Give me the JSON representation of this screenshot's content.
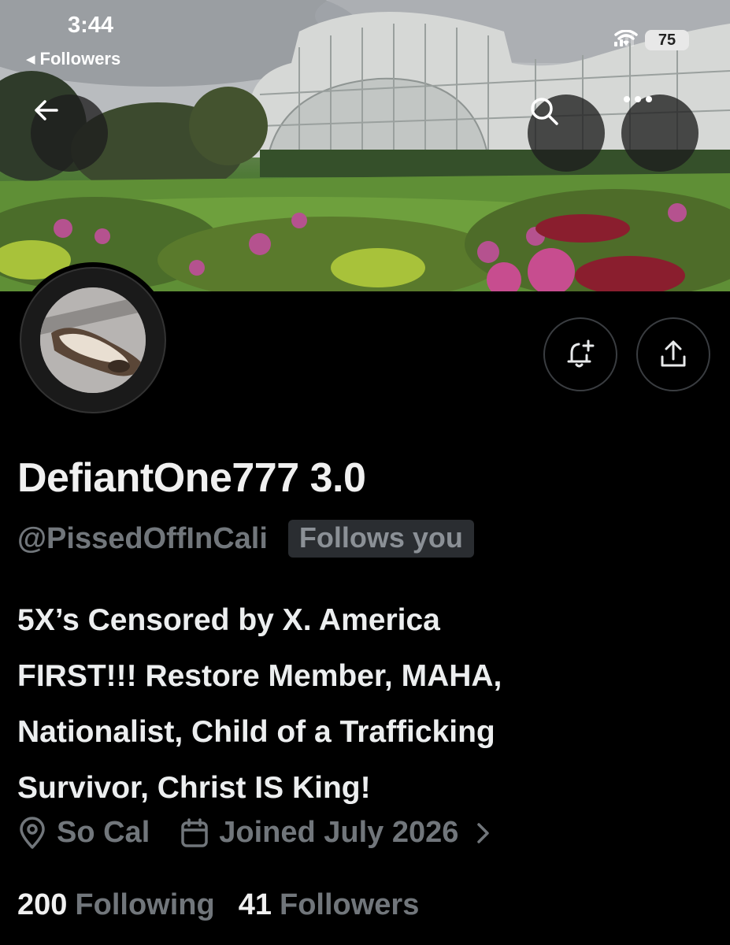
{
  "status_bar": {
    "time": "3:44",
    "back_label": "Followers",
    "battery": "75"
  },
  "profile": {
    "display_name": "DefiantOne777 3.0",
    "handle": "@PissedOffInCali",
    "follows_you": "Follows you",
    "bio_lines": [
      "5X’s Censored by X. America",
      "FIRST!!! Restore Member, MAHA,",
      "Nationalist, Child of a Trafficking",
      "Survivor, Christ IS King!"
    ],
    "location": "So Cal",
    "joined": "Joined July 2026",
    "following_count": "200",
    "following_label": "Following",
    "followers_count": "41",
    "followers_label": "Followers"
  },
  "icons": {
    "back": "arrow-left-icon",
    "search": "search-icon",
    "more": "more-icon",
    "notify": "bell-plus-icon",
    "share": "share-icon",
    "location": "location-pin-icon",
    "calendar": "calendar-icon",
    "chevron": "chevron-right-icon"
  },
  "colors": {
    "background": "#000000",
    "text_primary": "#e7e9ea",
    "text_secondary": "#71767b",
    "badge_bg": "#2a2d31"
  }
}
